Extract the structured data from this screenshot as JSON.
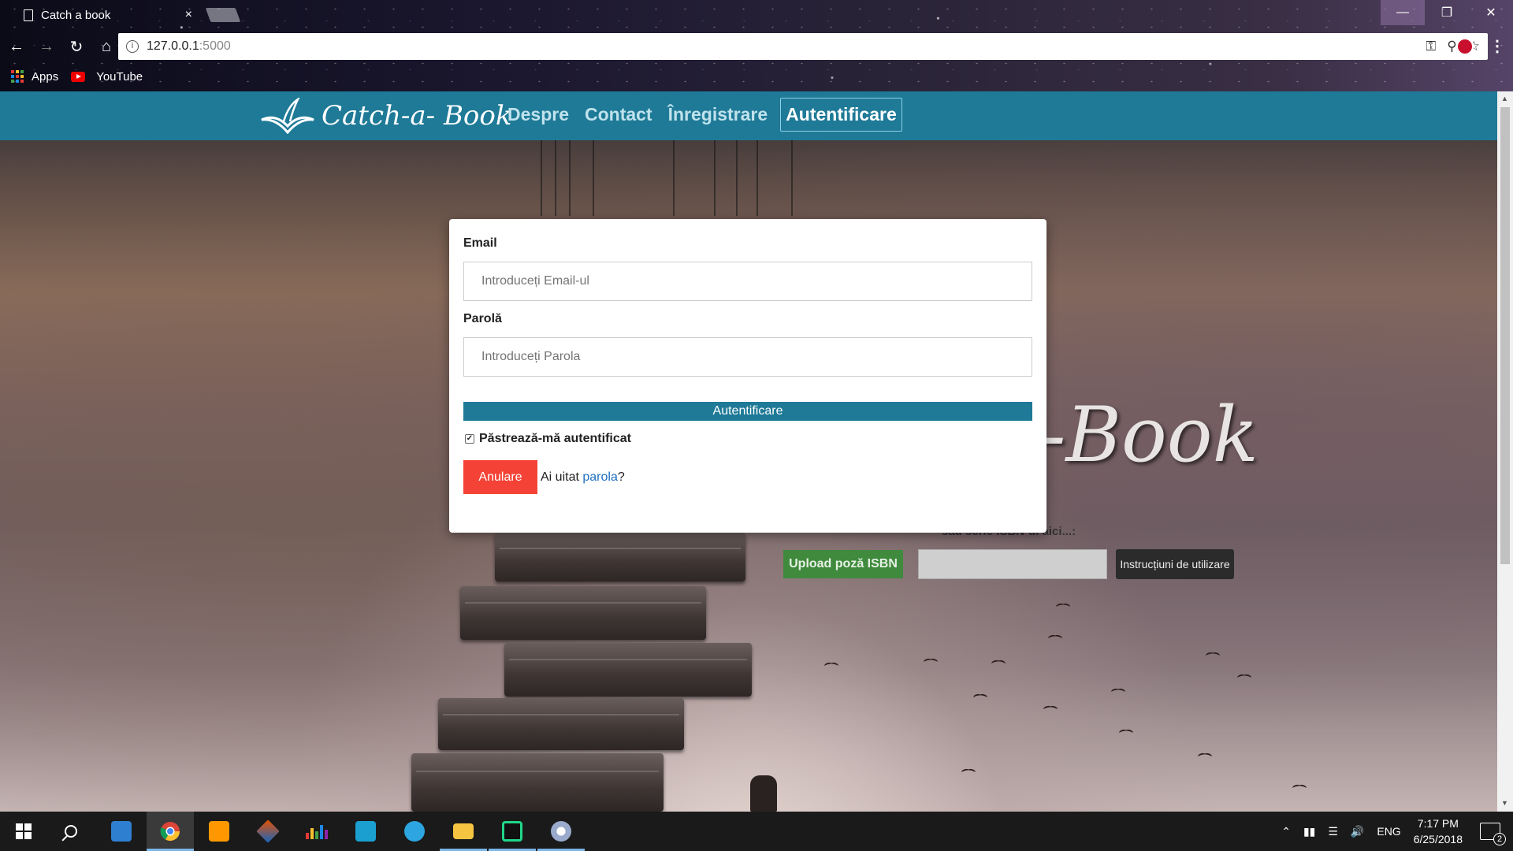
{
  "browser": {
    "tab_title": "Catch a book",
    "tab_close": "×",
    "url_host": "127.0.0.1",
    "url_port": ":5000",
    "bookmarks": [
      {
        "label": "Apps",
        "icon": "apps-grid-icon"
      },
      {
        "label": "YouTube",
        "icon": "youtube-icon"
      }
    ],
    "window_controls": {
      "minimize": "—",
      "maximize": "❐",
      "close": "✕"
    }
  },
  "site": {
    "logo_text": "Catch-a- Book",
    "nav": [
      {
        "label": "Despre",
        "active": false
      },
      {
        "label": "Contact",
        "active": false
      },
      {
        "label": "Înregistrare",
        "active": false
      },
      {
        "label": "Autentificare",
        "active": true
      }
    ],
    "hero_title": "-Book",
    "isbn_caption": "sau scrie ISBN-ul aici...:",
    "upload_button": "Upload poză ISBN",
    "instructions_button": "Instrucțiuni de utilizare"
  },
  "login_modal": {
    "email_label": "Email",
    "email_placeholder": "Introduceți Email-ul",
    "email_value": "",
    "password_label": "Parolă",
    "password_placeholder": "Introduceți Parola",
    "password_value": "",
    "submit_label": "Autentificare",
    "remember_label": "Păstrează-mă autentificat",
    "remember_checked": true,
    "cancel_label": "Anulare",
    "forgot_prefix": "Ai uitat ",
    "forgot_link": "parola",
    "forgot_suffix": "?"
  },
  "taskbar": {
    "apps": [
      {
        "name": "start",
        "icon": "windows-start-icon"
      },
      {
        "name": "search",
        "icon": "search-icon"
      },
      {
        "name": "explorer-pc",
        "icon": "this-pc-icon"
      },
      {
        "name": "chrome",
        "icon": "chrome-icon",
        "active": true
      },
      {
        "name": "sublime",
        "icon": "sublime-text-icon"
      },
      {
        "name": "matlab",
        "icon": "matlab-icon"
      },
      {
        "name": "equalizer",
        "icon": "equalizer-icon"
      },
      {
        "name": "instagram",
        "icon": "instagram-icon"
      },
      {
        "name": "telegram",
        "icon": "telegram-icon"
      },
      {
        "name": "file-explorer",
        "icon": "folder-icon",
        "running": true
      },
      {
        "name": "pycharm",
        "icon": "pycharm-icon",
        "running": true
      },
      {
        "name": "paint",
        "icon": "paint-icon",
        "running": true
      }
    ],
    "language": "ENG",
    "time": "7:17 PM",
    "date": "6/25/2018",
    "notifications": "2"
  },
  "colors": {
    "navbar": "#1e7a97",
    "cancel": "#f44336",
    "upload": "#3f8a3d",
    "link": "#1e70c2"
  }
}
